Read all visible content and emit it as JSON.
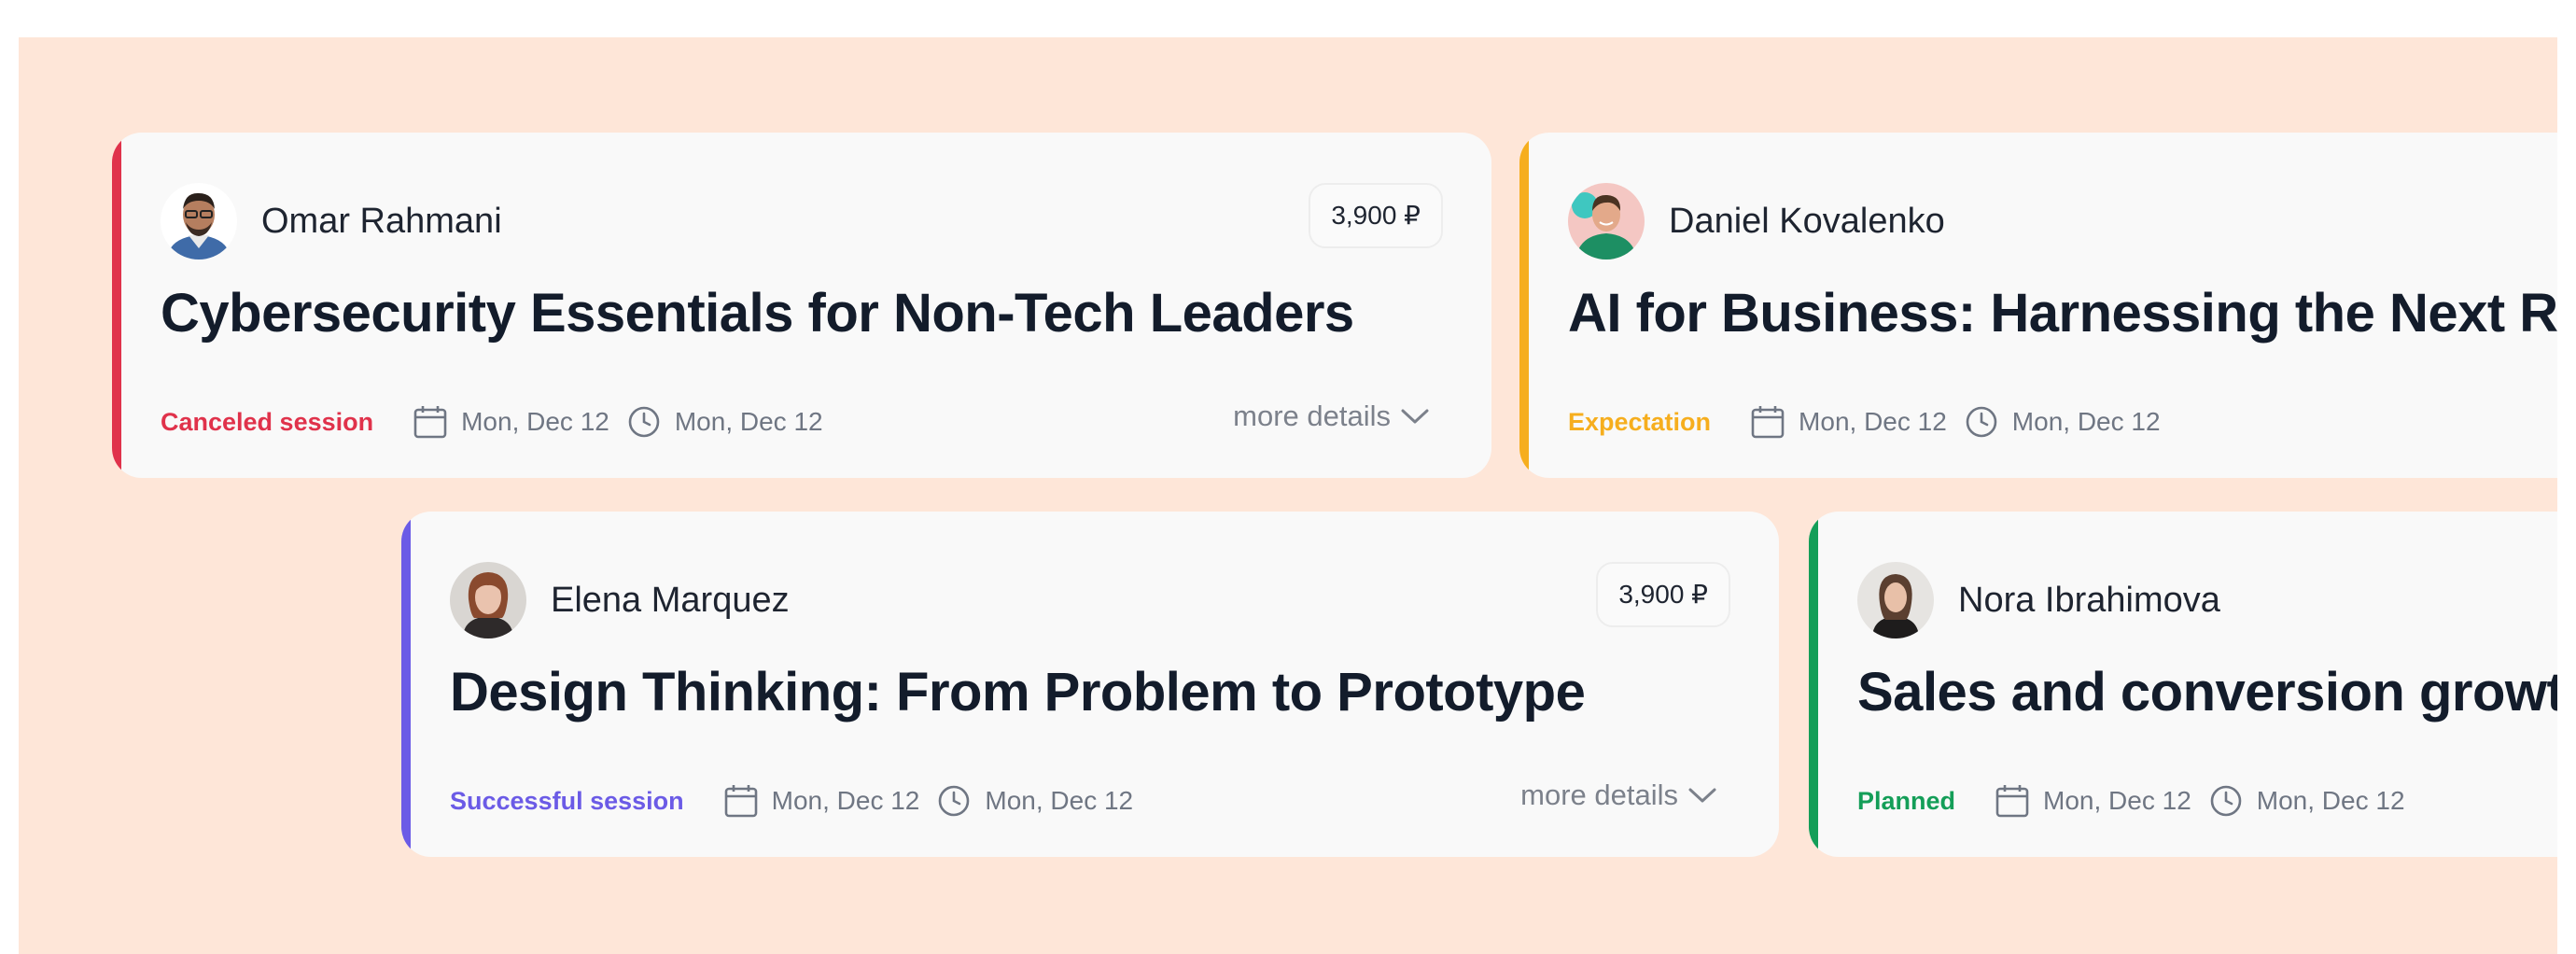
{
  "colors": {
    "background": "#FEE6D8",
    "card": "#F9F9F9",
    "canceled": "#E0324B",
    "expectation": "#F6AE1E",
    "successful": "#6B5BE6",
    "planned": "#149E58",
    "muted": "#6F7683"
  },
  "cards": [
    {
      "author": "Omar Rahmani",
      "price": "3,900 ₽",
      "title": "Cybersecurity Essentials for Non-Tech Leaders",
      "status": "Canceled session",
      "date": "Mon, Dec 12",
      "time": "Mon, Dec 12",
      "details": "more details",
      "icons": [
        "calendar-icon",
        "clock-icon",
        "chevron-down-icon"
      ]
    },
    {
      "author": "Daniel Kovalenko",
      "title": "AI for Business: Harnessing the Next Re",
      "status": "Expectation",
      "date": "Mon, Dec 12",
      "time": "Mon, Dec 12",
      "icons": [
        "calendar-icon",
        "clock-icon"
      ]
    },
    {
      "author": "Elena Marquez",
      "price": "3,900 ₽",
      "title": "Design Thinking: From Problem to Prototype",
      "status": "Successful session",
      "date": "Mon, Dec 12",
      "time": "Mon, Dec 12",
      "details": "more details",
      "icons": [
        "calendar-icon",
        "clock-icon",
        "chevron-down-icon"
      ]
    },
    {
      "author": "Nora Ibrahimova",
      "title": "Sales and conversion growt",
      "status": "Planned",
      "date": "Mon, Dec 12",
      "time": "Mon, Dec 12",
      "icons": [
        "calendar-icon",
        "clock-icon"
      ]
    }
  ]
}
